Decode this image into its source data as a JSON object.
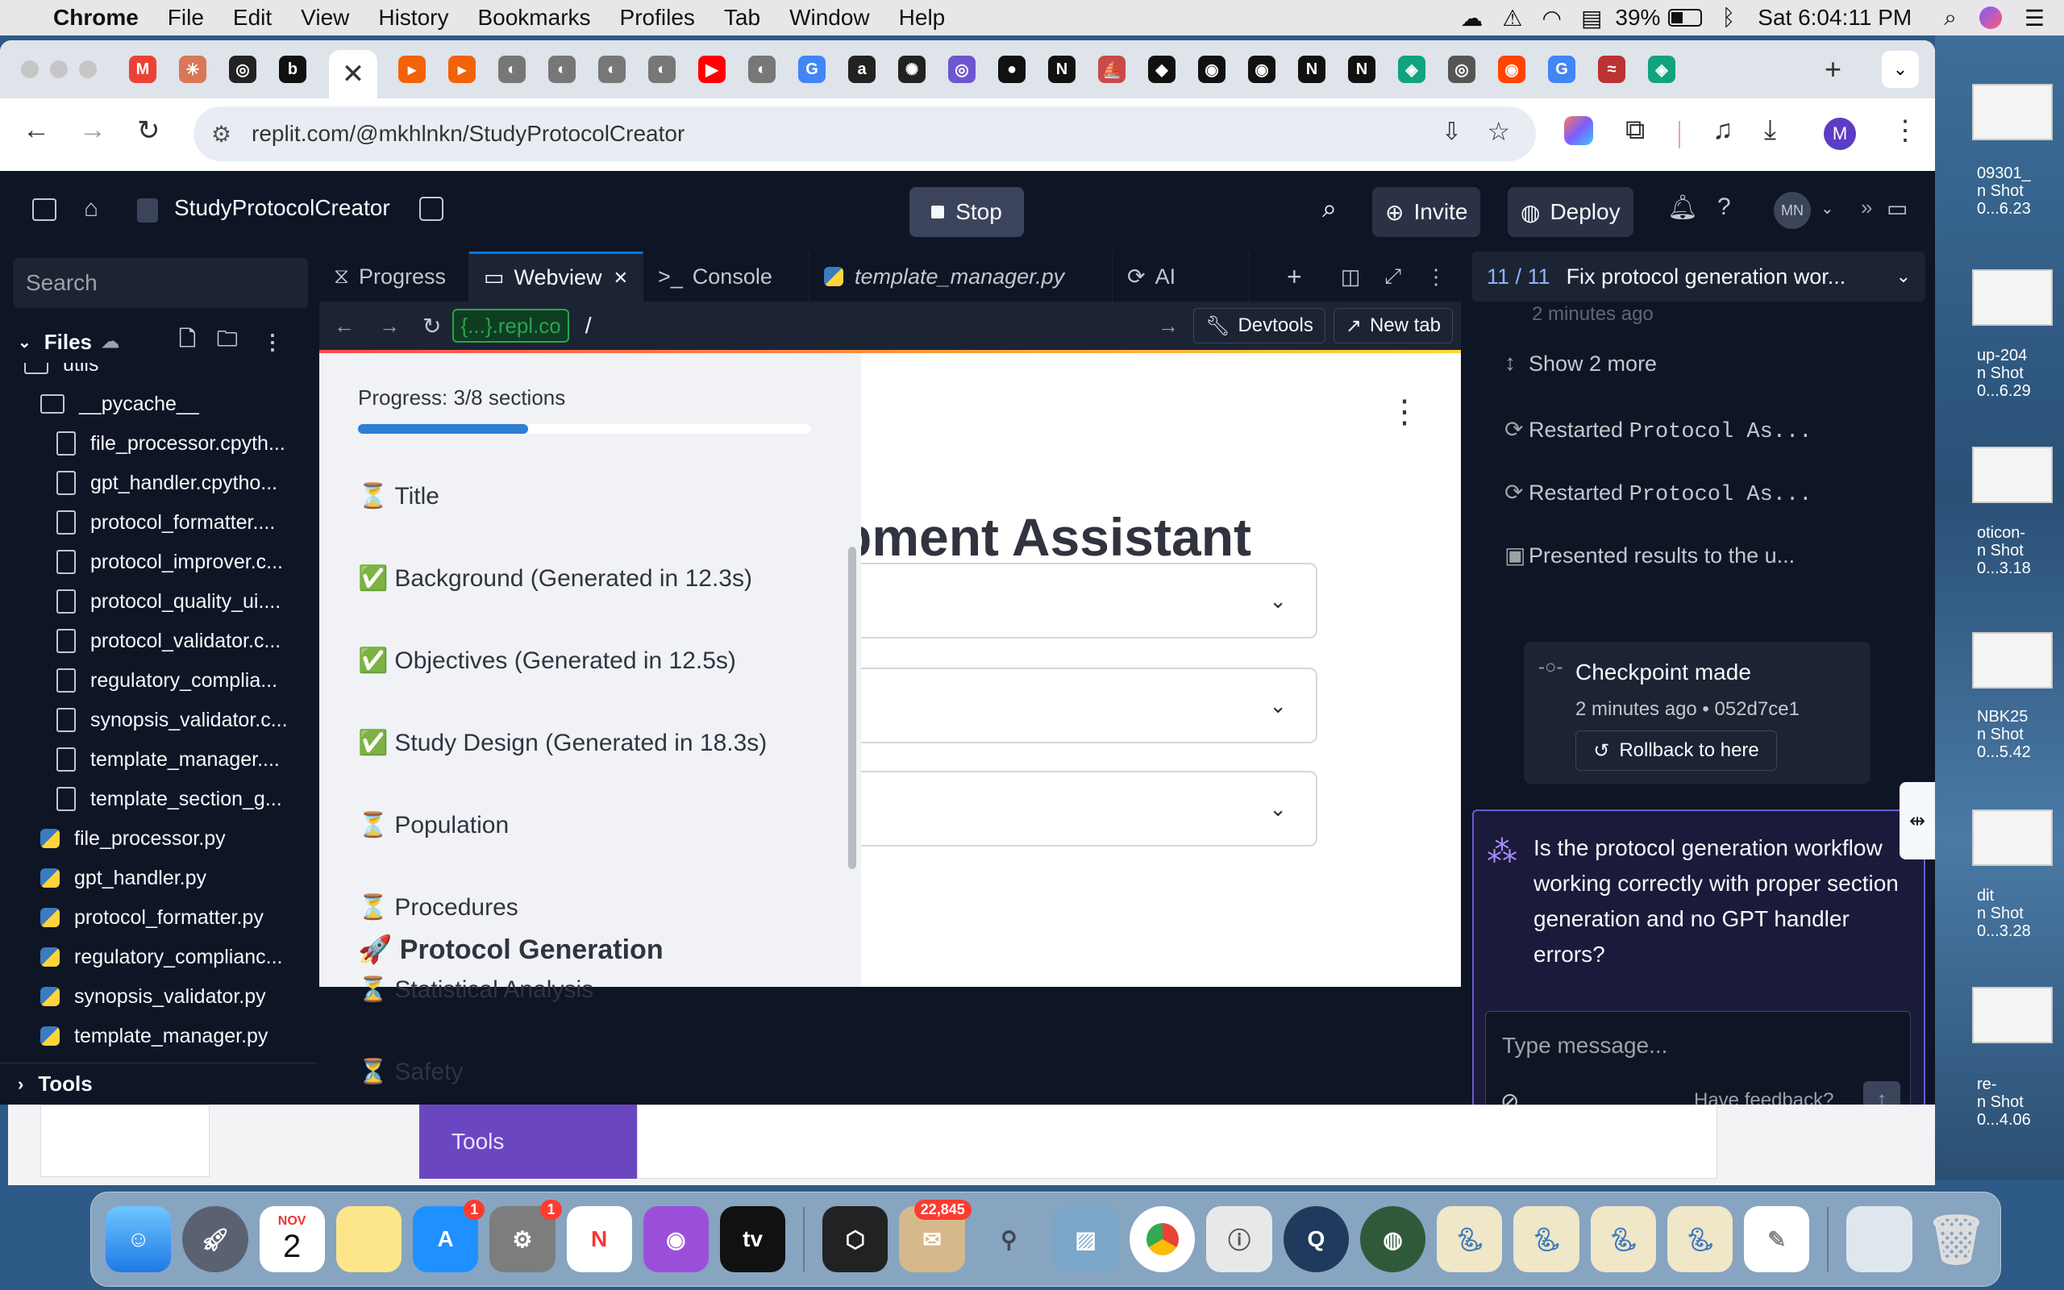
{
  "menubar": {
    "app": "Chrome",
    "items": [
      "File",
      "Edit",
      "View",
      "History",
      "Bookmarks",
      "Profiles",
      "Tab",
      "Window",
      "Help"
    ],
    "battery": "39%",
    "clock": "Sat 6:04:11 PM"
  },
  "browser": {
    "url": "replit.com/@mkhlnkn/StudyProtocolCreator",
    "tabs": [
      {
        "icon": "M",
        "color": "#ea4335"
      },
      {
        "icon": "✳",
        "color": "#d97757"
      },
      {
        "icon": "◎",
        "color": "#222222"
      },
      {
        "icon": "b",
        "color": "#111111"
      },
      {
        "icon": "▸",
        "color": "#f26207"
      },
      {
        "icon": "▸",
        "color": "#f26207"
      },
      {
        "icon": "◐",
        "color": "#777777"
      },
      {
        "icon": "◐",
        "color": "#777777"
      },
      {
        "icon": "◐",
        "color": "#777777"
      },
      {
        "icon": "◐",
        "color": "#777777"
      },
      {
        "icon": "▶",
        "color": "#ff0000"
      },
      {
        "icon": "◐",
        "color": "#777777"
      },
      {
        "icon": "G",
        "color": "#4285f4"
      },
      {
        "icon": "a",
        "color": "#222222"
      },
      {
        "icon": "✺",
        "color": "#222222"
      },
      {
        "icon": "◎",
        "color": "#6e56cf"
      },
      {
        "icon": "●",
        "color": "#111111"
      },
      {
        "icon": "N",
        "color": "#111111"
      },
      {
        "icon": "⛵",
        "color": "#c94a4a"
      },
      {
        "icon": "◆",
        "color": "#111111"
      },
      {
        "icon": "◉",
        "color": "#111111"
      },
      {
        "icon": "◉",
        "color": "#111111"
      },
      {
        "icon": "N",
        "color": "#111111"
      },
      {
        "icon": "N",
        "color": "#111111"
      },
      {
        "icon": "◈",
        "color": "#10a37f"
      },
      {
        "icon": "◎",
        "color": "#555555"
      },
      {
        "icon": "◉",
        "color": "#ff4500"
      },
      {
        "icon": "G",
        "color": "#4285f4"
      },
      {
        "icon": "≈",
        "color": "#b33"
      },
      {
        "icon": "◈",
        "color": "#10a37f"
      }
    ],
    "profile_initial": "M"
  },
  "replit": {
    "project_name": "StudyProtocolCreator",
    "stop_label": "Stop",
    "invite_label": "Invite",
    "deploy_label": "Deploy",
    "avatar_initials": "MN",
    "search_placeholder": "Search",
    "files_label": "Files",
    "tools_label": "Tools",
    "files": [
      {
        "name": "utils",
        "type": "folder",
        "indent": 1
      },
      {
        "name": "__pycache__",
        "type": "folder",
        "indent": 2
      },
      {
        "name": "file_processor.cpyth...",
        "type": "doc",
        "indent": 3
      },
      {
        "name": "gpt_handler.cpytho...",
        "type": "doc",
        "indent": 3
      },
      {
        "name": "protocol_formatter....",
        "type": "doc",
        "indent": 3
      },
      {
        "name": "protocol_improver.c...",
        "type": "doc",
        "indent": 3
      },
      {
        "name": "protocol_quality_ui....",
        "type": "doc",
        "indent": 3
      },
      {
        "name": "protocol_validator.c...",
        "type": "doc",
        "indent": 3
      },
      {
        "name": "regulatory_complia...",
        "type": "doc",
        "indent": 3
      },
      {
        "name": "synopsis_validator.c...",
        "type": "doc",
        "indent": 3
      },
      {
        "name": "template_manager....",
        "type": "doc",
        "indent": 3
      },
      {
        "name": "template_section_g...",
        "type": "doc",
        "indent": 3
      },
      {
        "name": "file_processor.py",
        "type": "py",
        "indent": 2
      },
      {
        "name": "gpt_handler.py",
        "type": "py",
        "indent": 2
      },
      {
        "name": "protocol_formatter.py",
        "type": "py",
        "indent": 2
      },
      {
        "name": "regulatory_complianc...",
        "type": "py",
        "indent": 2
      },
      {
        "name": "synopsis_validator.py",
        "type": "py",
        "indent": 2
      },
      {
        "name": "template_manager.py",
        "type": "py",
        "indent": 2
      }
    ],
    "pane_tabs": {
      "progress": "Progress",
      "webview": "Webview",
      "console": "Console",
      "template": "template_manager.py",
      "ai": "AI"
    },
    "webview_url": {
      "domain": "{...}.repl.co",
      "path": "/",
      "devtools": "Devtools",
      "new_tab": "New tab"
    }
  },
  "app": {
    "progress_label": "Progress: 3/8 sections",
    "progress_fraction": 0.375,
    "sections": [
      {
        "icon": "⏳",
        "label": "Title"
      },
      {
        "icon": "✅",
        "label": "Background (Generated in 12.3s)"
      },
      {
        "icon": "✅",
        "label": "Objectives (Generated in 12.5s)"
      },
      {
        "icon": "✅",
        "label": "Study Design (Generated in 18.3s)"
      },
      {
        "icon": "⏳",
        "label": "Population"
      },
      {
        "icon": "⏳",
        "label": "Procedures"
      },
      {
        "icon": "⏳",
        "label": "Statistical Analysis"
      },
      {
        "icon": "⏳",
        "label": "Safety"
      }
    ],
    "generation_heading": "🚀 Protocol Generation",
    "main_title_visible": "pment Assistant"
  },
  "agent": {
    "header_count": "11 / 11",
    "header_title": "Fix protocol generation wor...",
    "time_ago_top": "2 minutes ago",
    "show_more": "Show 2 more",
    "actions": [
      {
        "icon": "⟳",
        "prefix": "Restarted ",
        "mono": "Protocol As..."
      },
      {
        "icon": "⟳",
        "prefix": "Restarted ",
        "mono": "Protocol As..."
      },
      {
        "icon": "▣",
        "prefix": "Presented results to the u...",
        "mono": ""
      }
    ],
    "checkpoint_title": "Checkpoint made",
    "checkpoint_meta": "2 minutes ago • 052d7ce1",
    "rollback_label": "Rollback to here",
    "question": "Is the protocol generation workflow working correctly with proper section generation and no GPT handler errors?",
    "input_placeholder": "Type message...",
    "feedback_label": "Have feedback?"
  },
  "desktop": {
    "labels": [
      "09301_",
      "n Shot",
      "0...6.23",
      "up-204",
      "n Shot",
      "0...6.29",
      "oticon-",
      "n Shot",
      "0...3.18",
      "NBK25",
      "n Shot",
      "0...5.42",
      "dit",
      "n Shot",
      "0...3.28",
      "re-",
      "n Shot",
      "0...4.06"
    ],
    "bg_tools": "Tools"
  },
  "dock": {
    "calendar_month": "NOV",
    "calendar_day": "2",
    "appstore_badge": "1",
    "settings_badge": "1",
    "mail_badge": "22,845",
    "tv_label": "tv"
  }
}
